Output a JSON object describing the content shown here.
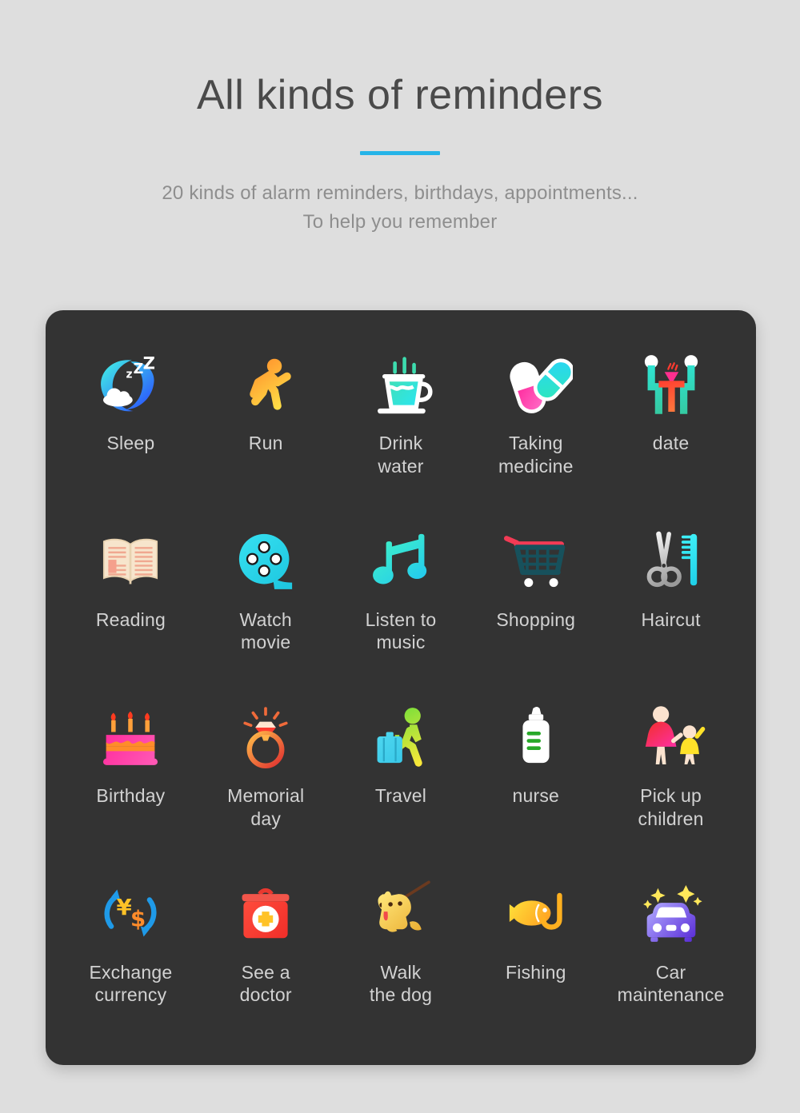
{
  "header": {
    "title": "All kinds of reminders",
    "accent_color": "#25b4e8",
    "subtitle_line1": "20 kinds of alarm reminders, birthdays, appointments...",
    "subtitle_line2": "To help you remember"
  },
  "card": {
    "background_color": "#333333",
    "label_color": "#d2d2d2",
    "items": [
      {
        "label": "Sleep",
        "icon": "sleep-moon-icon"
      },
      {
        "label": "Run",
        "icon": "running-person-icon"
      },
      {
        "label": "Drink\nwater",
        "icon": "water-cup-icon"
      },
      {
        "label": "Taking\nmedicine",
        "icon": "pills-icon"
      },
      {
        "label": "date",
        "icon": "date-dining-icon"
      },
      {
        "label": "Reading",
        "icon": "open-book-icon"
      },
      {
        "label": "Watch\nmovie",
        "icon": "film-reel-icon"
      },
      {
        "label": "Listen to\nmusic",
        "icon": "music-note-icon"
      },
      {
        "label": "Shopping",
        "icon": "shopping-cart-icon"
      },
      {
        "label": "Haircut",
        "icon": "scissors-comb-icon"
      },
      {
        "label": "Birthday",
        "icon": "birthday-cake-icon"
      },
      {
        "label": "Memorial\nday",
        "icon": "diamond-ring-icon"
      },
      {
        "label": "Travel",
        "icon": "traveler-suitcase-icon"
      },
      {
        "label": "nurse",
        "icon": "baby-bottle-icon"
      },
      {
        "label": "Pick up\nchildren",
        "icon": "parent-child-icon"
      },
      {
        "label": "Exchange\ncurrency",
        "icon": "currency-exchange-icon"
      },
      {
        "label": "See a\ndoctor",
        "icon": "medical-kit-icon"
      },
      {
        "label": "Walk\nthe dog",
        "icon": "dog-leash-icon"
      },
      {
        "label": "Fishing",
        "icon": "fish-hook-icon"
      },
      {
        "label": "Car\nmaintenance",
        "icon": "car-sparkle-icon"
      }
    ]
  }
}
